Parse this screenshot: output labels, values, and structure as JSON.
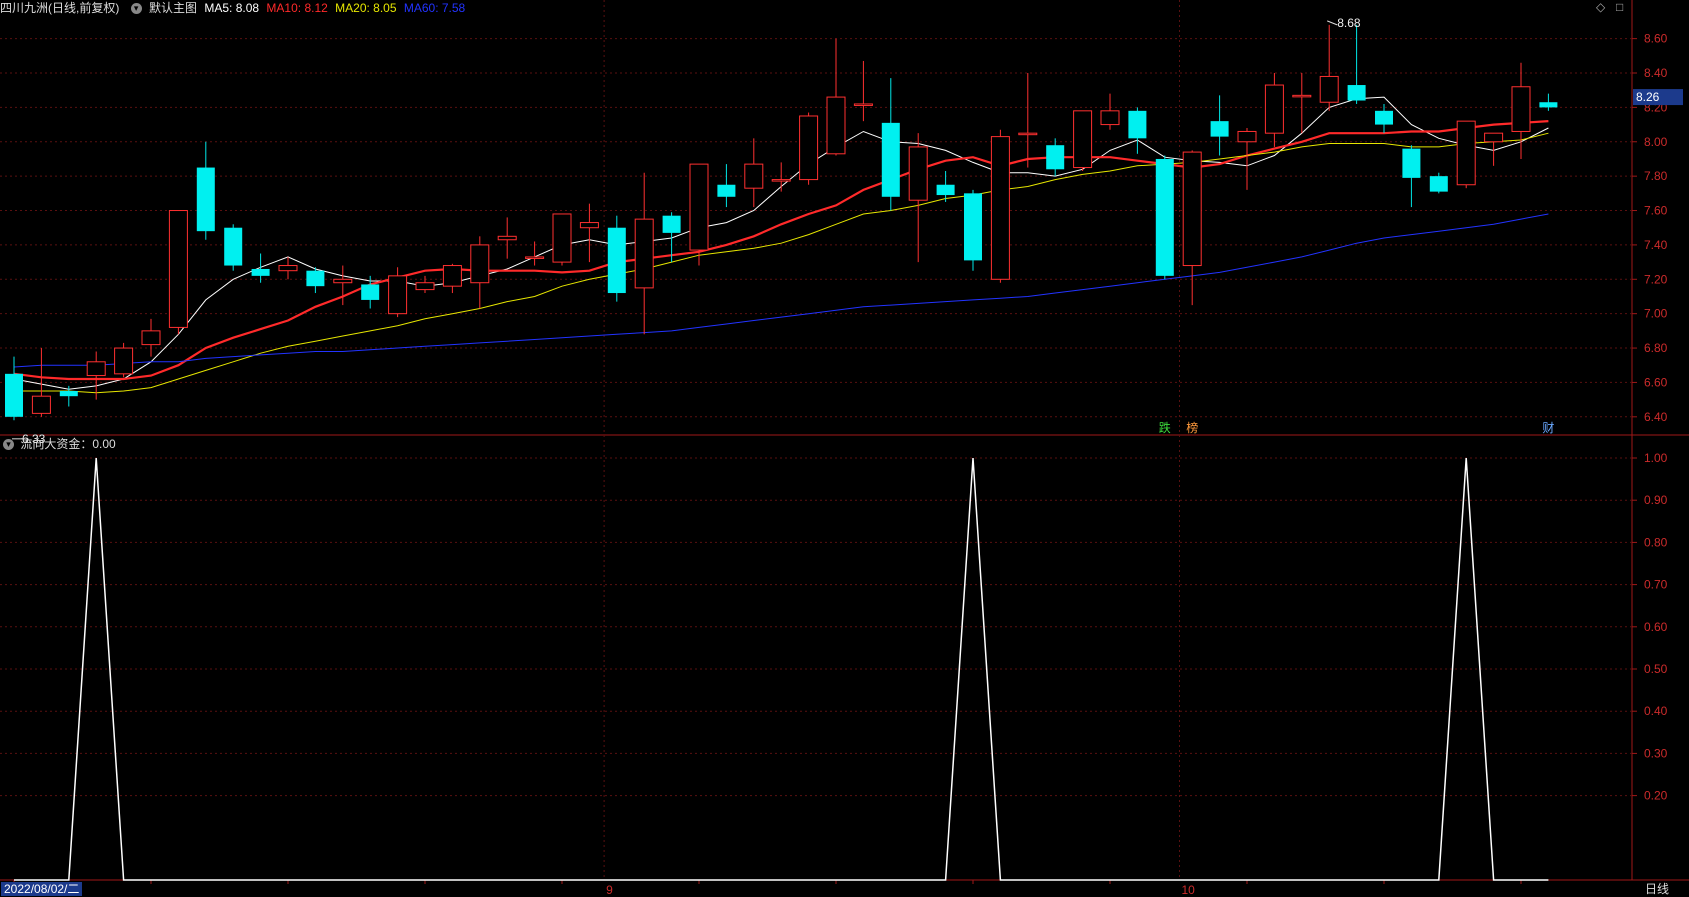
{
  "header": {
    "stock": "四川九洲(日线,前复权)",
    "main_label": "默认主图",
    "ma5": "MA5: 8.08",
    "ma10": "MA10: 8.12",
    "ma20": "MA20: 8.05",
    "ma60": "MA60: 7.58",
    "colors": {
      "ma5": "#ffffff",
      "ma10": "#ff2a2a",
      "ma20": "#e6e600",
      "ma60": "#2233ff"
    }
  },
  "sub_header": {
    "label": "流向大资金：0.00"
  },
  "bottom": {
    "date": "2022/08/02/二",
    "period": "日线"
  },
  "corner_icons": [
    "diamond-icon",
    "square-icon"
  ],
  "chart_data": [
    {
      "type": "candlestick",
      "title": "四川九洲(日线,前复权)",
      "y_ticks": [
        "8.60",
        "8.40",
        "8.20",
        "8.00",
        "7.80",
        "7.60",
        "7.40",
        "7.20",
        "7.00",
        "6.80",
        "6.60",
        "6.40"
      ],
      "ylim": [
        6.3,
        8.72
      ],
      "x_ticks": [
        {
          "label": "9",
          "index": 22
        },
        {
          "label": "10",
          "index": 43
        }
      ],
      "current_price": "8.26",
      "annotations": [
        {
          "text": "6.33",
          "index": 0,
          "value": 6.33
        },
        {
          "text": "8.68",
          "index": 48,
          "value": 8.68
        }
      ],
      "markers": [
        {
          "text": "跌",
          "index": 42,
          "color": "#3cdc3c"
        },
        {
          "text": "榜",
          "index": 43,
          "color": "#ff9a3c"
        },
        {
          "text": "财",
          "index": 56,
          "color": "#6aa8ff"
        }
      ],
      "candles": [
        [
          6.65,
          6.4,
          6.75,
          6.38
        ],
        [
          6.42,
          6.52,
          6.8,
          6.4
        ],
        [
          6.55,
          6.52,
          6.58,
          6.46
        ],
        [
          6.64,
          6.72,
          6.78,
          6.5
        ],
        [
          6.65,
          6.8,
          6.83,
          6.63
        ],
        [
          6.82,
          6.9,
          6.97,
          6.75
        ],
        [
          6.92,
          7.6,
          7.6,
          6.88
        ],
        [
          7.85,
          7.48,
          8.0,
          7.43
        ],
        [
          7.5,
          7.28,
          7.52,
          7.25
        ],
        [
          7.26,
          7.22,
          7.35,
          7.18
        ],
        [
          7.25,
          7.28,
          7.33,
          7.2
        ],
        [
          7.25,
          7.16,
          7.27,
          7.12
        ],
        [
          7.18,
          7.2,
          7.28,
          7.05
        ],
        [
          7.17,
          7.08,
          7.22,
          7.03
        ],
        [
          7.0,
          7.22,
          7.27,
          6.98
        ],
        [
          7.14,
          7.18,
          7.22,
          7.12
        ],
        [
          7.16,
          7.28,
          7.29,
          7.12
        ],
        [
          7.18,
          7.4,
          7.45,
          7.03
        ],
        [
          7.43,
          7.45,
          7.56,
          7.32
        ],
        [
          7.33,
          7.33,
          7.42,
          7.28
        ],
        [
          7.3,
          7.58,
          7.58,
          7.28
        ],
        [
          7.5,
          7.53,
          7.64,
          7.3
        ],
        [
          7.5,
          7.12,
          7.57,
          7.07
        ],
        [
          7.15,
          7.55,
          7.82,
          6.88
        ],
        [
          7.57,
          7.47,
          7.59,
          7.3
        ],
        [
          7.37,
          7.87,
          7.87,
          7.28
        ],
        [
          7.75,
          7.68,
          7.87,
          7.62
        ],
        [
          7.73,
          7.87,
          8.02,
          7.62
        ],
        [
          7.78,
          7.78,
          7.88,
          7.71
        ],
        [
          7.78,
          8.15,
          8.17,
          7.75
        ],
        [
          7.93,
          8.26,
          8.6,
          7.92
        ],
        [
          8.22,
          8.22,
          8.47,
          8.12
        ],
        [
          8.11,
          7.68,
          8.37,
          7.6
        ],
        [
          7.66,
          7.97,
          8.05,
          7.3
        ],
        [
          7.75,
          7.69,
          7.83,
          7.65
        ],
        [
          7.7,
          7.31,
          7.72,
          7.25
        ],
        [
          7.2,
          8.03,
          8.07,
          7.18
        ],
        [
          8.05,
          8.05,
          8.4,
          7.85
        ],
        [
          7.98,
          7.84,
          8.02,
          7.8
        ],
        [
          7.85,
          8.18,
          8.18,
          7.83
        ],
        [
          8.1,
          8.18,
          8.28,
          8.07
        ],
        [
          8.18,
          8.02,
          8.2,
          7.93
        ],
        [
          7.9,
          7.22,
          7.92,
          7.2
        ],
        [
          7.28,
          7.94,
          7.95,
          7.05
        ],
        [
          8.12,
          8.03,
          8.27,
          7.92
        ],
        [
          8.0,
          8.06,
          8.08,
          7.72
        ],
        [
          8.05,
          8.33,
          8.4,
          7.97
        ],
        [
          8.27,
          8.27,
          8.4,
          8.05
        ],
        [
          8.23,
          8.38,
          8.68,
          8.18
        ],
        [
          8.33,
          8.24,
          8.68,
          8.22
        ],
        [
          8.18,
          8.1,
          8.22,
          8.05
        ],
        [
          7.96,
          7.79,
          7.98,
          7.62
        ],
        [
          7.8,
          7.71,
          7.82,
          7.7
        ],
        [
          7.75,
          8.12,
          8.12,
          7.73
        ],
        [
          8.0,
          8.05,
          8.05,
          7.86
        ],
        [
          8.06,
          8.32,
          8.46,
          7.9
        ],
        [
          8.23,
          8.2,
          8.28,
          8.18
        ]
      ],
      "series": [
        {
          "name": "MA5",
          "values": [
            6.62,
            6.59,
            6.56,
            6.58,
            6.62,
            6.72,
            6.88,
            7.08,
            7.2,
            7.27,
            7.33,
            7.26,
            7.22,
            7.19,
            7.19,
            7.16,
            7.18,
            7.22,
            7.26,
            7.33,
            7.4,
            7.43,
            7.4,
            7.42,
            7.44,
            7.5,
            7.53,
            7.6,
            7.74,
            7.87,
            7.97,
            8.06,
            8.0,
            7.99,
            7.95,
            7.88,
            7.82,
            7.82,
            7.8,
            7.84,
            7.95,
            8.01,
            7.91,
            7.89,
            7.88,
            7.86,
            7.92,
            8.05,
            8.2,
            8.25,
            8.26,
            8.1,
            8.02,
            7.98,
            7.95,
            8.0,
            8.08
          ]
        },
        {
          "name": "MA10",
          "values": [
            6.65,
            6.63,
            6.62,
            6.62,
            6.62,
            6.64,
            6.7,
            6.8,
            6.86,
            6.91,
            6.96,
            7.04,
            7.1,
            7.17,
            7.21,
            7.25,
            7.26,
            7.25,
            7.25,
            7.25,
            7.24,
            7.25,
            7.3,
            7.32,
            7.34,
            7.36,
            7.4,
            7.45,
            7.52,
            7.58,
            7.63,
            7.72,
            7.78,
            7.84,
            7.89,
            7.91,
            7.86,
            7.9,
            7.91,
            7.91,
            7.91,
            7.89,
            7.87,
            7.85,
            7.87,
            7.92,
            7.96,
            8.0,
            8.05,
            8.05,
            8.05,
            8.06,
            8.06,
            8.08,
            8.1,
            8.11,
            8.12
          ]
        },
        {
          "name": "MA20",
          "values": [
            6.55,
            6.55,
            6.55,
            6.54,
            6.55,
            6.57,
            6.62,
            6.67,
            6.72,
            6.77,
            6.81,
            6.84,
            6.87,
            6.9,
            6.93,
            6.97,
            7.0,
            7.03,
            7.07,
            7.1,
            7.16,
            7.2,
            7.23,
            7.26,
            7.3,
            7.34,
            7.36,
            7.38,
            7.41,
            7.46,
            7.52,
            7.58,
            7.6,
            7.63,
            7.67,
            7.69,
            7.72,
            7.74,
            7.78,
            7.81,
            7.83,
            7.86,
            7.87,
            7.88,
            7.9,
            7.92,
            7.94,
            7.97,
            7.99,
            7.99,
            7.99,
            7.97,
            7.97,
            7.99,
            8.0,
            8.01,
            8.05
          ]
        },
        {
          "name": "MA60",
          "values": [
            6.69,
            6.7,
            6.7,
            6.7,
            6.71,
            6.72,
            6.72,
            6.74,
            6.75,
            6.76,
            6.77,
            6.78,
            6.78,
            6.79,
            6.8,
            6.81,
            6.82,
            6.83,
            6.84,
            6.85,
            6.86,
            6.87,
            6.88,
            6.89,
            6.9,
            6.92,
            6.94,
            6.96,
            6.98,
            7.0,
            7.02,
            7.04,
            7.05,
            7.06,
            7.07,
            7.08,
            7.09,
            7.1,
            7.12,
            7.14,
            7.16,
            7.18,
            7.2,
            7.22,
            7.24,
            7.27,
            7.3,
            7.33,
            7.37,
            7.41,
            7.44,
            7.46,
            7.48,
            7.5,
            7.52,
            7.55,
            7.58
          ]
        }
      ]
    },
    {
      "type": "line",
      "title": "流向大资金",
      "y_ticks": [
        "1.00",
        "0.90",
        "0.80",
        "0.70",
        "0.60",
        "0.50",
        "0.40",
        "0.30",
        "0.20"
      ],
      "ylim": [
        0.0,
        1.0
      ],
      "series": [
        {
          "name": "流向大资金",
          "values": [
            0,
            0,
            0,
            1,
            0,
            0,
            0,
            0,
            0,
            0,
            0,
            0,
            0,
            0,
            0,
            0,
            0,
            0,
            0,
            0,
            0,
            0,
            0,
            0,
            0,
            0,
            0,
            0,
            0,
            0,
            0,
            0,
            0,
            0,
            0,
            1,
            0,
            0,
            0,
            0,
            0,
            0,
            0,
            0,
            0,
            0,
            0,
            0,
            0,
            0,
            0,
            0,
            0,
            1,
            0,
            0,
            0
          ]
        }
      ]
    }
  ]
}
